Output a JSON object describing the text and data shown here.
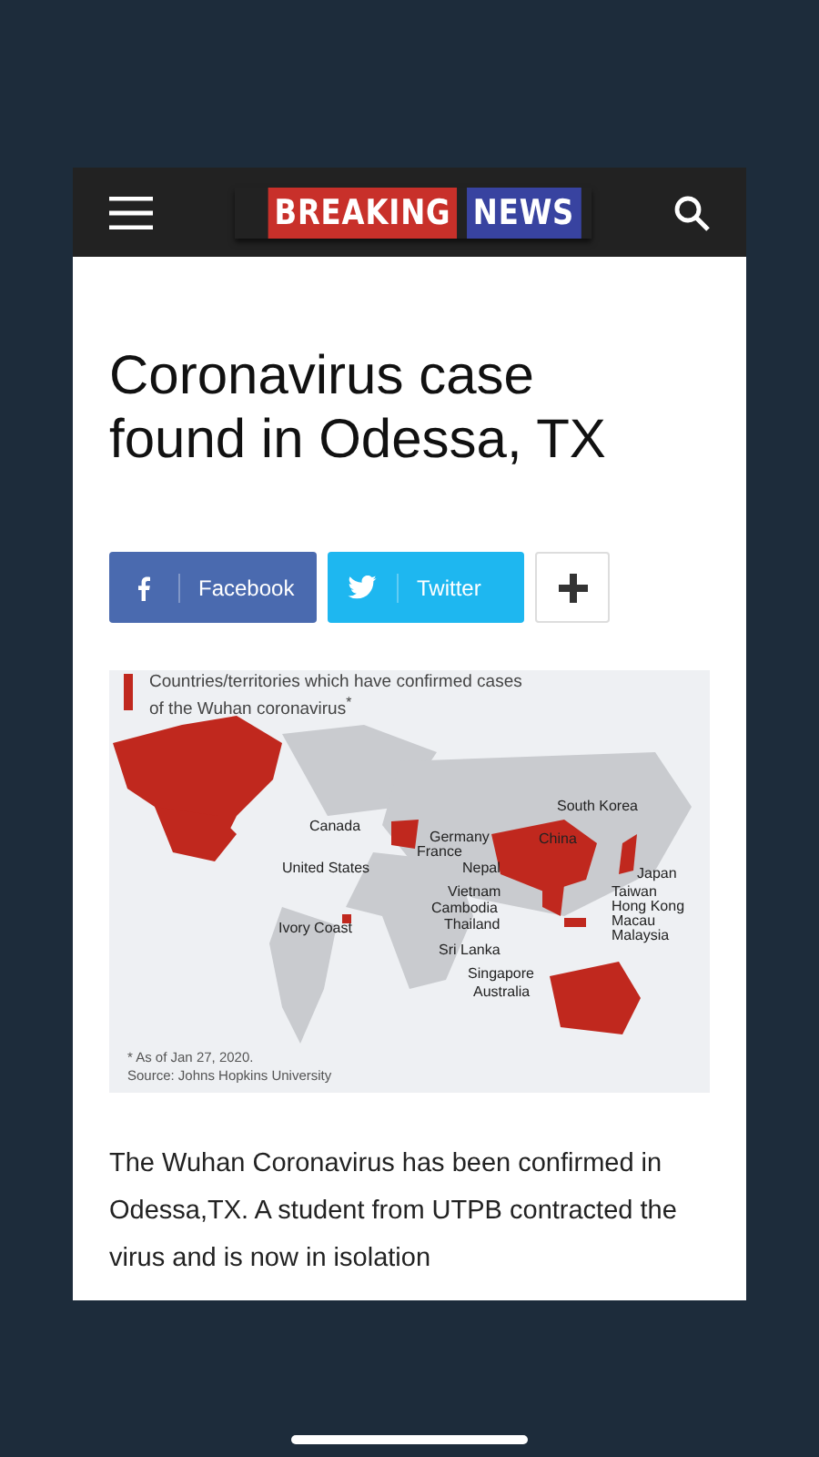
{
  "header": {
    "logo": [
      "BREAKING",
      "NEWS"
    ]
  },
  "article": {
    "title": "Coronavirus case found in Odessa, TX",
    "share": [
      {
        "kind": "facebook",
        "label": "Facebook"
      },
      {
        "kind": "twitter",
        "label": "Twitter"
      },
      {
        "kind": "more"
      }
    ],
    "map": {
      "title": "Countries/territories which have confirmed cases of the Wuhan coronavirus$^{*}$",
      "labels": [
        "Canada",
        "United States",
        "Germany",
        "France",
        "South Korea",
        "China",
        "Nepal",
        "Japan",
        "Vietnam",
        "Cambodia",
        "Thailand",
        "Taiwan",
        "Hong Kong",
        "Macau",
        "Malaysia",
        "Ivory Coast",
        "Sri Lanka",
        "Singapore",
        "Australia"
      ],
      "footnote": "* As of Jan 27, 2020.",
      "source": "Source: Johns Hopkins University"
    },
    "body": "The Wuhan Coronavirus has been confirmed in Odessa,TX. A student from UTPB contracted the virus and is now in isolation"
  }
}
